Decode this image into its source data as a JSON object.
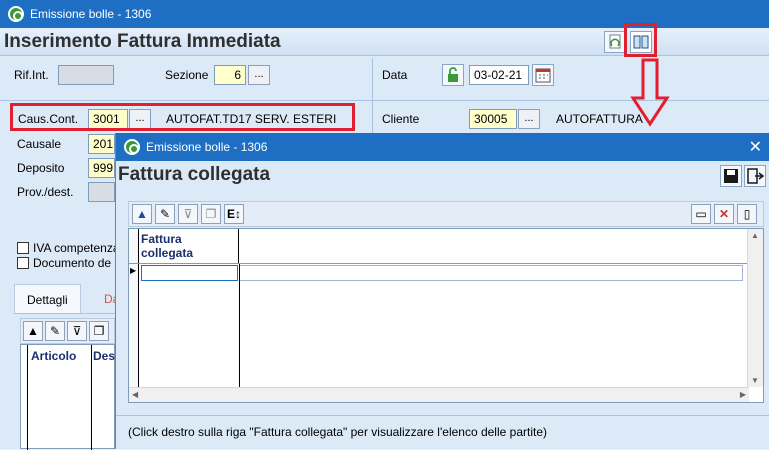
{
  "main": {
    "window_title": "Emissione bolle - 1306",
    "page_title": "Inserimento Fattura Immediata",
    "fields": {
      "rif_int_label": "Rif.Int.",
      "rif_int_value": "",
      "sezione_label": "Sezione",
      "sezione_value": "6",
      "data_label": "Data",
      "data_value": "03-02-21",
      "caus_cont_label": "Caus.Cont.",
      "caus_cont_value": "3001",
      "caus_cont_desc": "AUTOFAT.TD17 SERV. ESTERI",
      "cliente_label": "Cliente",
      "cliente_value": "30005",
      "cliente_desc": "AUTOFATTURA",
      "causale_label": "Causale",
      "causale_value": "201",
      "deposito_label": "Deposito",
      "deposito_value": "999",
      "prov_dest_label": "Prov./dest.",
      "iva_competenza_label": "IVA competenza",
      "documento_label": "Documento de"
    },
    "dots_label": "...",
    "tabs": [
      {
        "label": "Dettagli"
      },
      {
        "label": "Da"
      }
    ],
    "subgrid_headers": [
      "Articolo",
      "Des"
    ]
  },
  "dialog": {
    "window_title": "Emissione bolle - 1306",
    "title": "Fattura collegata",
    "close_glyph": "✕",
    "grid": {
      "columns": [
        "Fattura collegata"
      ]
    },
    "footer_note": "(Click destro sulla riga \"Fattura collegata\" per visualizzare l'elenco delle partite)"
  },
  "colors": {
    "titlebar": "#1e6fc4",
    "highlight": "#e02030",
    "field_yellow": "#ffffcc"
  }
}
